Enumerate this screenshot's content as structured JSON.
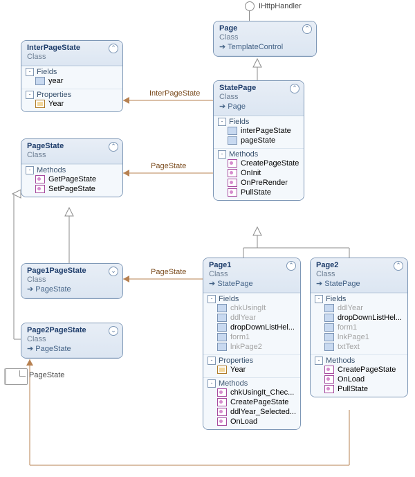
{
  "interface": {
    "name": "IHttpHandler"
  },
  "labels": {
    "class": "Class",
    "fields": "Fields",
    "properties": "Properties",
    "methods": "Methods"
  },
  "page": {
    "name": "Page",
    "base": "TemplateControl"
  },
  "interPageState": {
    "name": "InterPageState",
    "f": {
      "year": "year"
    },
    "p": {
      "Year": "Year"
    }
  },
  "pageState": {
    "name": "PageState",
    "m": {
      "get": "GetPageState",
      "set": "SetPageState"
    }
  },
  "page1PageState": {
    "name": "Page1PageState",
    "base": "PageState"
  },
  "page2PageState": {
    "name": "Page2PageState",
    "base": "PageState"
  },
  "statePage": {
    "name": "StatePage",
    "base": "Page",
    "f": {
      "inter": "interPageState",
      "ps": "pageState"
    },
    "m": {
      "cps": "CreatePageState",
      "oninit": "OnInit",
      "opr": "OnPreRender",
      "pull": "PullState"
    }
  },
  "page1": {
    "name": "Page1",
    "base": "StatePage",
    "f": {
      "chk": "chkUsingIt",
      "ddl": "ddlYear",
      "ddlh": "dropDownListHel...",
      "form": "form1",
      "lnk": "lnkPage2"
    },
    "p": {
      "Year": "Year"
    },
    "m": {
      "chkch": "chkUsingIt_Chec...",
      "cps": "CreatePageState",
      "ddlsel": "ddlYear_Selected...",
      "onload": "OnLoad"
    }
  },
  "page2": {
    "name": "Page2",
    "base": "StatePage",
    "f": {
      "ddl": "ddlYear",
      "ddlh": "dropDownListHel...",
      "form": "form1",
      "lnk": "lnkPage1",
      "txt": "txtText"
    },
    "m": {
      "cps": "CreatePageState",
      "onload": "OnLoad",
      "pull": "PullState"
    }
  },
  "conn": {
    "interPageState": "InterPageState",
    "pageState": "PageState"
  },
  "assoc": {
    "pageState": "PageState"
  }
}
